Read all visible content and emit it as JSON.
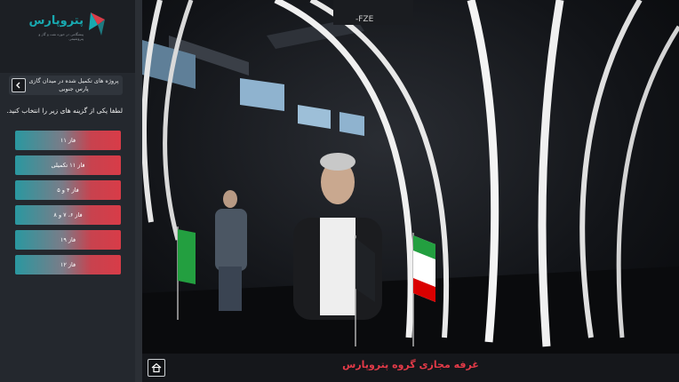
{
  "brand": {
    "name": "پتروپارس",
    "tagline": "پیشگامی در حوزه نفت و گاز و پتروشیمی",
    "colors": {
      "teal": "#18a9b0",
      "red": "#d83c48"
    }
  },
  "sidebar": {
    "project_title": "پروژه های تکمیل شده در میدان گازی پارس جنوبی",
    "back_icon": "chevron-left-icon",
    "prompt": "لطفا یکی از گزینه های زیر را انتخاب کنید.",
    "phases": [
      {
        "label": "فاز ۱۱"
      },
      {
        "label": "فاز ۱۱ تکمیلی"
      },
      {
        "label": "فاز ۴ و ۵"
      },
      {
        "label": "فاز ۶، ۷ و ۸"
      },
      {
        "label": "فاز ۱۹"
      },
      {
        "label": "فاز ۱۲"
      }
    ]
  },
  "scene": {
    "sign_text": "-FZE"
  },
  "bottom_bar": {
    "home_icon": "home-icon",
    "title": "غرفه مجازی گروه پتروپارس"
  }
}
